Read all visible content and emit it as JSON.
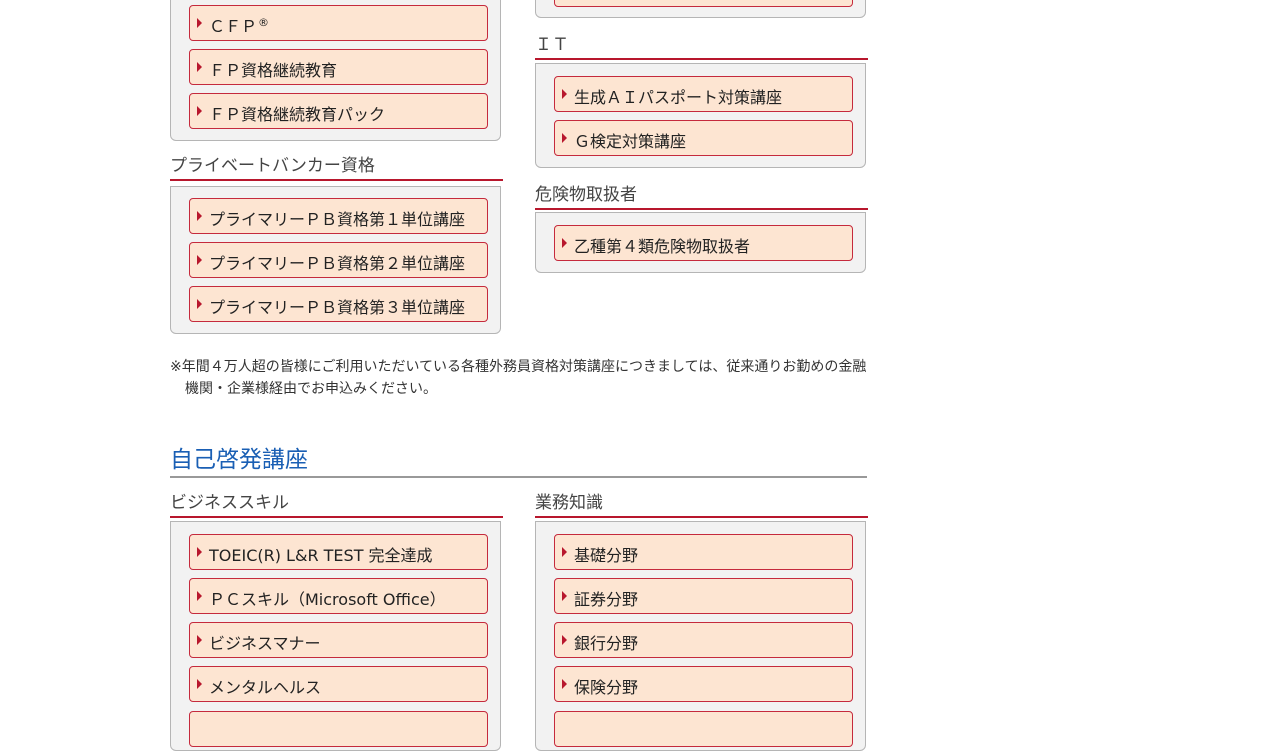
{
  "qualification": {
    "cfp_group": {
      "items": [
        {
          "label": "ＣＦＰ",
          "sup": "®"
        },
        {
          "label": "ＦＰ資格継続教育"
        },
        {
          "label": "ＦＰ資格継続教育パック"
        }
      ]
    },
    "private_banker": {
      "title": "プライベートバンカー資格",
      "items": [
        {
          "label": "プライマリーＰＢ資格第１単位講座"
        },
        {
          "label": "プライマリーＰＢ資格第２単位講座"
        },
        {
          "label": "プライマリーＰＢ資格第３単位講座"
        }
      ]
    },
    "it": {
      "title": "ＩＴ",
      "items": [
        {
          "label": "生成ＡＩパスポート対策講座"
        },
        {
          "label": "Ｇ検定対策講座"
        }
      ]
    },
    "hazmat": {
      "title": "危険物取扱者",
      "items": [
        {
          "label": "乙種第４類危険物取扱者"
        }
      ]
    }
  },
  "note": "※年間４万人超の皆様にご利用いただいている各種外務員資格対策講座につきましては、従来通りお勤めの金融機関・企業様経由でお申込みください。",
  "self_development": {
    "title": "自己啓発講座",
    "business_skill": {
      "title": "ビジネススキル",
      "items": [
        {
          "label": "TOEIC(R) L&R TEST 完全達成"
        },
        {
          "label": "ＰＣスキル（Microsoft Office）"
        },
        {
          "label": "ビジネスマナー"
        },
        {
          "label": "メンタルヘルス"
        }
      ]
    },
    "business_knowledge": {
      "title": "業務知識",
      "items": [
        {
          "label": "基礎分野"
        },
        {
          "label": "証券分野"
        },
        {
          "label": "銀行分野"
        },
        {
          "label": "保険分野"
        }
      ]
    }
  },
  "colors": {
    "accent_red": "#b8172d",
    "button_fill": "#fde5d2",
    "panel_fill": "#f2f2f2",
    "section_blue": "#1a5fb4"
  }
}
